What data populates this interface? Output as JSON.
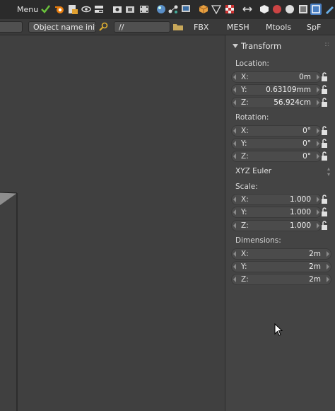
{
  "topbar": {
    "menu_label": "Menu",
    "icons": [
      "checkmark-icon",
      "blender-icon",
      "file-lock-icon",
      "eye-icon",
      "toggle-icon",
      "camera-icon",
      "render-icon",
      "film-icon",
      "sphere-icon",
      "nodes-icon",
      "screen-icon",
      "cube-orange-icon",
      "wire-triangle-icon",
      "checker-icon",
      "arrows-icon",
      "solid-icon",
      "material-icon",
      "rendered-icon",
      "texture-icon",
      "active-view-icon",
      "pen-icon"
    ]
  },
  "secondbar": {
    "object_name_field": "Object name init...",
    "path_field": "//",
    "tabs": [
      "FBX",
      "MESH",
      "Mtools",
      "SpF"
    ]
  },
  "panel": {
    "title": "Transform",
    "location": {
      "label": "Location:",
      "rows": [
        {
          "axis": "X:",
          "value": "0m"
        },
        {
          "axis": "Y:",
          "value": "0.63109mm"
        },
        {
          "axis": "Z:",
          "value": "56.924cm"
        }
      ]
    },
    "rotation": {
      "label": "Rotation:",
      "rows": [
        {
          "axis": "X:",
          "value": "0°"
        },
        {
          "axis": "Y:",
          "value": "0°"
        },
        {
          "axis": "Z:",
          "value": "0°"
        }
      ],
      "mode": "XYZ Euler"
    },
    "scale": {
      "label": "Scale:",
      "rows": [
        {
          "axis": "X:",
          "value": "1.000"
        },
        {
          "axis": "Y:",
          "value": "1.000"
        },
        {
          "axis": "Z:",
          "value": "1.000"
        }
      ]
    },
    "dimensions": {
      "label": "Dimensions:",
      "rows": [
        {
          "axis": "X:",
          "value": "2m"
        },
        {
          "axis": "Y:",
          "value": "2m"
        },
        {
          "axis": "Z:",
          "value": "2m"
        }
      ]
    }
  }
}
